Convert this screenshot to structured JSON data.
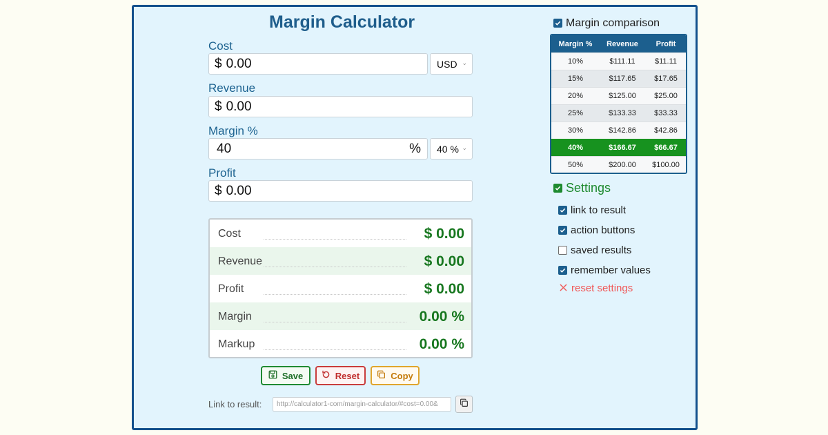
{
  "title": "Margin Calculator",
  "form": {
    "cost": {
      "label": "Cost",
      "prefix": "$",
      "value": "0.00"
    },
    "currency": {
      "selected": "USD"
    },
    "revenue": {
      "label": "Revenue",
      "prefix": "$",
      "value": "0.00"
    },
    "margin": {
      "label": "Margin %",
      "value": "40",
      "suffix": "%"
    },
    "margin_preset": {
      "selected": "40 %"
    },
    "profit": {
      "label": "Profit",
      "prefix": "$",
      "value": "0.00"
    }
  },
  "results": [
    {
      "label": "Cost",
      "value": "$ 0.00"
    },
    {
      "label": "Revenue",
      "value": "$ 0.00"
    },
    {
      "label": "Profit",
      "value": "$ 0.00"
    },
    {
      "label": "Margin",
      "value": "0.00 %"
    },
    {
      "label": "Markup",
      "value": "0.00 %"
    }
  ],
  "buttons": {
    "save": "Save",
    "reset": "Reset",
    "copy": "Copy"
  },
  "link": {
    "label": "Link to result:",
    "value": "http://calculator1-com/margin-calculator/#cost=0.00&"
  },
  "comparison": {
    "label": "Margin comparison",
    "checked": true,
    "headers": [
      "Margin %",
      "Revenue",
      "Profit"
    ],
    "rows": [
      [
        "10%",
        "$111.11",
        "$11.11"
      ],
      [
        "15%",
        "$117.65",
        "$17.65"
      ],
      [
        "20%",
        "$125.00",
        "$25.00"
      ],
      [
        "25%",
        "$133.33",
        "$33.33"
      ],
      [
        "30%",
        "$142.86",
        "$42.86"
      ],
      [
        "40%",
        "$166.67",
        "$66.67"
      ],
      [
        "50%",
        "$200.00",
        "$100.00"
      ]
    ],
    "highlighted_row": "40%"
  },
  "settings": {
    "title": "Settings",
    "options": [
      {
        "label": "link to result",
        "checked": true
      },
      {
        "label": "action buttons",
        "checked": true
      },
      {
        "label": "saved results",
        "checked": false
      },
      {
        "label": "remember values",
        "checked": true
      }
    ],
    "reset_label": "reset settings"
  },
  "colors": {
    "frame_border": "#13508c",
    "panel_bg": "#e2f4fd",
    "accent_blue": "#1c5f8e",
    "accent_green": "#17921f",
    "value_green": "#17771f",
    "reset_red": "#f05a5a",
    "copy_orange": "#e0a52c"
  }
}
